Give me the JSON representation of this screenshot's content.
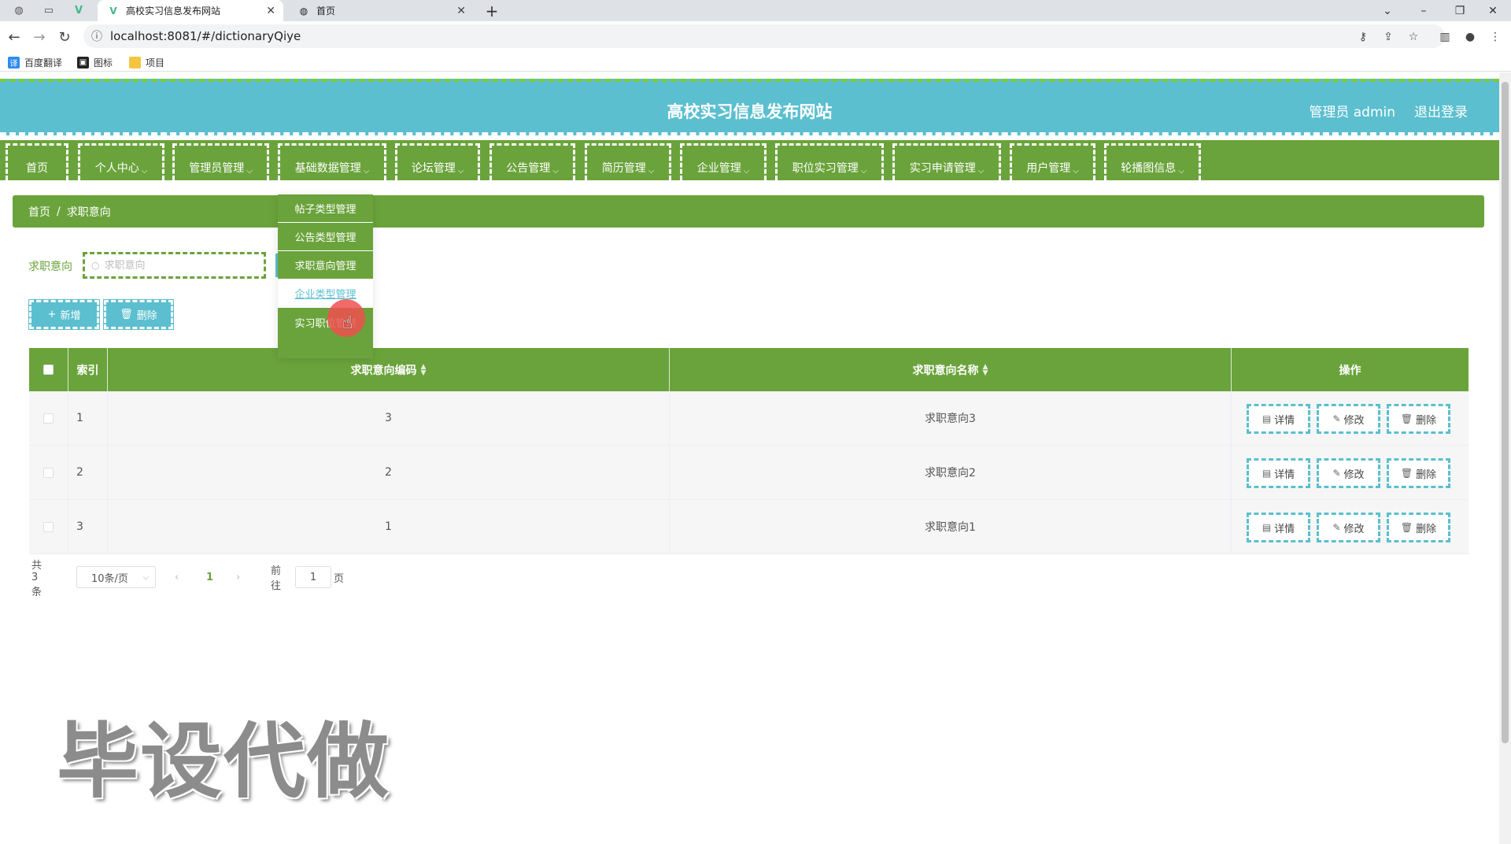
{
  "browser": {
    "tabs": [
      {
        "title": "高校实习信息发布网站",
        "icon": "vue-logo-icon",
        "active": true
      },
      {
        "title": "首页",
        "icon": "globe-icon",
        "active": false
      }
    ],
    "url": "localhost:8081/#/dictionaryQiye",
    "bookmarks": [
      {
        "label": "百度翻译",
        "icon": "translate-icon"
      },
      {
        "label": "图标",
        "icon": "bookmark-icon"
      },
      {
        "label": "项目",
        "icon": "folder-icon"
      }
    ]
  },
  "header": {
    "title": "高校实习信息发布网站",
    "user": "管理员 admin",
    "logout": "退出登录"
  },
  "menu": [
    "首页",
    "个人中心",
    "管理员管理",
    "基础数据管理",
    "论坛管理",
    "公告管理",
    "简历管理",
    "企业管理",
    "职位实习管理",
    "实习申请管理",
    "用户管理",
    "轮播图信息"
  ],
  "dropdown": {
    "items": [
      "帖子类型管理",
      "公告类型管理",
      "求职意向管理",
      "企业类型管理",
      "实习职位管理"
    ],
    "hovered_index": 3
  },
  "breadcrumb": {
    "home": "首页",
    "sep": "/",
    "current": "求职意向"
  },
  "search": {
    "label": "求职意向",
    "placeholder": "求职意向"
  },
  "actions": {
    "add": "新增",
    "delete": "删除"
  },
  "table": {
    "columns": {
      "index": "索引",
      "code": "求职意向编码",
      "name": "求职意向名称",
      "ops": "操作"
    },
    "rows": [
      {
        "index": "1",
        "code": "3",
        "name": "求职意向3"
      },
      {
        "index": "2",
        "code": "2",
        "name": "求职意向2"
      },
      {
        "index": "3",
        "code": "1",
        "name": "求职意向1"
      }
    ],
    "row_actions": {
      "detail": "详情",
      "edit": "修改",
      "delete": "删除"
    }
  },
  "pagination": {
    "total": "共 3 条",
    "page_size": "10条/页",
    "current_page": "1",
    "goto_label": "前往",
    "goto_value": "1",
    "page_unit": "页"
  },
  "watermark": "毕设代做",
  "colors": {
    "primary_green": "#6aa33b",
    "accent_cyan": "#5bbfcf"
  }
}
